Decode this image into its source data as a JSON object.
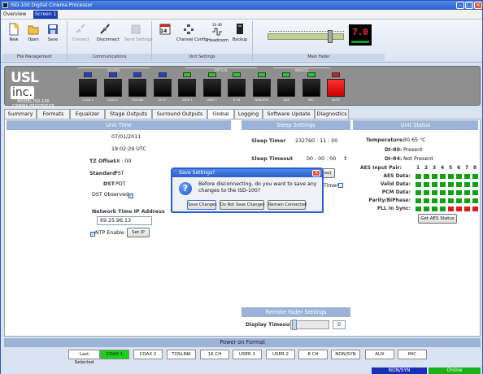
{
  "window": {
    "title": "ISD-100 Digital Cinema Processor"
  },
  "screen_tabs": [
    "Overview",
    "Screen 1"
  ],
  "ribbon": {
    "file_management": {
      "label": "File Management",
      "new": "New",
      "open": "Open",
      "save": "Save"
    },
    "communications": {
      "label": "Communications",
      "connect": "Connect",
      "disconnect": "Disconnect",
      "send_settings": "Send Settings"
    },
    "unit_settings": {
      "label": "Unit Settings",
      "calendar_day": "14",
      "channel_config": "Channel Config",
      "headroom": "Headroom",
      "headroom_db": "20 dB",
      "backup": "Backup"
    },
    "main_fader": {
      "label": "Main Fader",
      "value": "7.0",
      "position": 0.82
    }
  },
  "device": {
    "logo_main": "USL",
    "logo_inc": "inc.",
    "model_line1": "MODEL ISD-100",
    "model_line2": "CINEMA PROCESSOR",
    "group_labels": [
      "DIGITAL",
      "OPTICAL",
      "ANALOG"
    ],
    "inputs": [
      {
        "label": "COAX 1",
        "led": "#1f40d8"
      },
      {
        "label": "COAX 2",
        "led": "#1f40d8"
      },
      {
        "label": "TOSLINK",
        "led": "#1f40d8"
      },
      {
        "label": "16 CH",
        "led": "#1f40d8"
      },
      {
        "label": "USER 1",
        "led": "#2ec62e"
      },
      {
        "label": "USER 2",
        "led": "#2ec62e"
      },
      {
        "label": "8 CH",
        "led": "#2ec62e"
      },
      {
        "label": "NON/SYN",
        "led": "#2ec62e"
      },
      {
        "label": "AUX",
        "led": "#2ec62e"
      },
      {
        "label": "MIC",
        "led": "#2ec62e"
      },
      {
        "label": "MUTE",
        "led": "#d81c1c"
      }
    ]
  },
  "main_tabs": [
    "Summary",
    "Formats",
    "Equalizer",
    "Stage Outputs",
    "Surround Outputs",
    "Global",
    "Logging",
    "Software Update",
    "Diagnostics"
  ],
  "active_tab": "Global",
  "unit_time": {
    "header": "Unit Time",
    "date": "07/01/2011",
    "time": "19:02:29 UTC",
    "tz_label": "TZ Offset",
    "tz_value": "-8 : 00",
    "standard_label": "Standard",
    "standard_value": "PST",
    "dst_label": "DST",
    "dst_value": "PDT",
    "dst_observed": "DST Observed",
    "ntp_label": "Network Time IP Address",
    "ntp_ip": "69.25.96.13",
    "ntp_enable": "NTP Enable",
    "set_ip": "Set IP"
  },
  "sleep_settings": {
    "header": "Sleep Settings",
    "sleep_timer_label": "Sleep Timer",
    "sleep_timer_value": "232760 : 11 : 00",
    "sleep_timeout_label": "Sleep Timeout",
    "sleep_timeout_value": "00 : 00 : 00",
    "partial_button": "out",
    "partial_checkbox": "Timer"
  },
  "remote_fader": {
    "header": "Remote Fader Settings",
    "display_timeout_label": "Display Timeout",
    "display_timeout_value": "0"
  },
  "unit_status": {
    "header": "Unit Status",
    "temperature_label": "Temperature:",
    "temperature_value": "30.65 °C",
    "di80_label": "DI-80:",
    "di80_value": "Present",
    "di84_label": "DI-84:",
    "di84_value": "Not Present",
    "aes_pair_label": "AES Input Pair:",
    "aes_pairs": [
      "1",
      "2",
      "3",
      "4",
      "5",
      "6",
      "7",
      "8"
    ],
    "aes_rows": [
      {
        "label": "AES Data:",
        "states": [
          "ok",
          "ok",
          "ok",
          "ok",
          "ok",
          "ok",
          "ok",
          "ok"
        ]
      },
      {
        "label": "Valid Data:",
        "states": [
          "ok",
          "ok",
          "ok",
          "ok",
          "ok",
          "ok",
          "ok",
          "ok"
        ]
      },
      {
        "label": "PCM Data:",
        "states": [
          "ok",
          "ok",
          "ok",
          "ok",
          "ok",
          "ok",
          "ok",
          "ok"
        ]
      },
      {
        "label": "Parity/BiPhase:",
        "states": [
          "ok",
          "ok",
          "ok",
          "ok",
          "ok",
          "ok",
          "ok",
          "ok"
        ]
      },
      {
        "label": "PLL In Sync:",
        "states": [
          "ok",
          "ok",
          "ok",
          "ok",
          "err",
          "err",
          "err",
          "err"
        ]
      }
    ],
    "status_colors": {
      "ok": "#13a113",
      "err": "#e01a1a"
    },
    "get_aes_button": "Get AES Status"
  },
  "power_on_format": {
    "header": "Power on Format",
    "options": [
      "Last Selected",
      "COAX 1",
      "COAX 2",
      "TOSLINK",
      "16 CH",
      "USER 1",
      "USER 2",
      "8 CH",
      "NON/SYN",
      "AUX",
      "MIC"
    ],
    "selected": "COAX 1"
  },
  "status_bar": {
    "format": "NON/SYN",
    "connection": "Online",
    "format_color": "#1a2fb5",
    "connection_color": "#19b419"
  },
  "dialog": {
    "title": "Save Settings?",
    "message": "Before disconnecting, do you want to save any changes to the ISD-100?",
    "save": "Save Changes",
    "dont_save": "Do Not Save Changes",
    "remain": "Remain Connected"
  }
}
